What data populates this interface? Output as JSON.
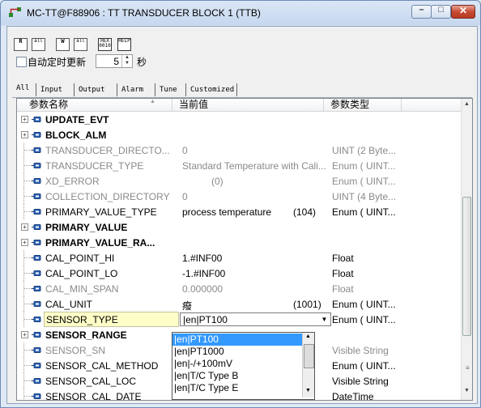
{
  "window": {
    "title": "MC-TT@F88906 : TT TRANSDUCER BLOCK 1 (TTB)",
    "controls": {
      "minimize": "–",
      "maximize": "□",
      "close": "✕"
    }
  },
  "toolbar": {
    "buttons": [
      {
        "name": "read-button",
        "glyph": "R"
      },
      {
        "name": "read-all-button",
        "glyph": "all"
      },
      {
        "name": "write-button",
        "glyph": "W"
      },
      {
        "name": "write-all-button",
        "glyph": "all"
      },
      {
        "name": "hex-button",
        "glyph": "HEX 0010"
      },
      {
        "name": "help-button",
        "glyph": "HELP"
      }
    ],
    "auto_refresh_label": "自动定时更新",
    "interval_value": "5",
    "interval_unit": "秒"
  },
  "tabs": [
    "All",
    "Input",
    "Output",
    "Alarm",
    "Tune",
    "Customized"
  ],
  "columns": {
    "name": "参数名称",
    "value": "当前值",
    "type": "参数类型"
  },
  "rows": [
    {
      "name": "UPDATE_EVT",
      "value": "",
      "num": "",
      "type": "",
      "style": "bold",
      "expandable": true
    },
    {
      "name": "BLOCK_ALM",
      "value": "",
      "num": "",
      "type": "",
      "style": "bold",
      "expandable": true
    },
    {
      "name": "TRANSDUCER_DIRECTO...",
      "value": "0",
      "num": "",
      "type": "UINT (2 Byte...",
      "style": "grey"
    },
    {
      "name": "TRANSDUCER_TYPE",
      "value": "Standard Temperature with Cali...",
      "num": "",
      "type": "Enum ( UINT...",
      "style": "grey"
    },
    {
      "name": "XD_ERROR",
      "value": "(0)",
      "num": "",
      "type": "Enum ( UINT...",
      "style": "grey"
    },
    {
      "name": "COLLECTION_DIRECTORY",
      "value": "0",
      "num": "",
      "type": "UINT (4 Byte...",
      "style": "grey"
    },
    {
      "name": "PRIMARY_VALUE_TYPE",
      "value": "process temperature",
      "num": "(104)",
      "type": "Enum ( UINT...",
      "style": "normal"
    },
    {
      "name": "PRIMARY_VALUE",
      "value": "",
      "num": "",
      "type": "",
      "style": "bold",
      "expandable": true
    },
    {
      "name": "PRIMARY_VALUE_RA...",
      "value": "",
      "num": "",
      "type": "",
      "style": "bold",
      "expandable": true
    },
    {
      "name": "CAL_POINT_HI",
      "value": "1.#INF00",
      "num": "",
      "type": "Float",
      "style": "normal"
    },
    {
      "name": "CAL_POINT_LO",
      "value": "-1.#INF00",
      "num": "",
      "type": "Float",
      "style": "normal"
    },
    {
      "name": "CAL_MIN_SPAN",
      "value": "0.000000",
      "num": "",
      "type": "Float",
      "style": "grey"
    },
    {
      "name": "CAL_UNIT",
      "value": "癈",
      "num": "(1001)",
      "type": "Enum ( UINT...",
      "style": "normal"
    },
    {
      "name": "SENSOR_TYPE",
      "value": "|en|PT100",
      "num": "",
      "type": "Enum ( UINT...",
      "style": "selected"
    },
    {
      "name": "SENSOR_RANGE",
      "value": "",
      "num": "",
      "type": "",
      "style": "bold",
      "expandable": true
    },
    {
      "name": "SENSOR_SN",
      "value": "",
      "num": "",
      "type": "Visible String",
      "style": "grey"
    },
    {
      "name": "SENSOR_CAL_METHOD",
      "value": "",
      "num": "",
      "type": "Enum ( UINT...",
      "style": "normal"
    },
    {
      "name": "SENSOR_CAL_LOC",
      "value": "",
      "num": "",
      "type": "Visible String",
      "style": "normal"
    },
    {
      "name": "SENSOR_CAL_DATE",
      "value": "",
      "num": "",
      "type": "DateTime",
      "style": "normal"
    }
  ],
  "dropdown": {
    "selected": "|en|PT100",
    "options": [
      "|en|PT100",
      "|en|PT1000",
      "|en|-/+100mV",
      "|en|T/C Type B",
      "|en|T/C Type E"
    ]
  }
}
